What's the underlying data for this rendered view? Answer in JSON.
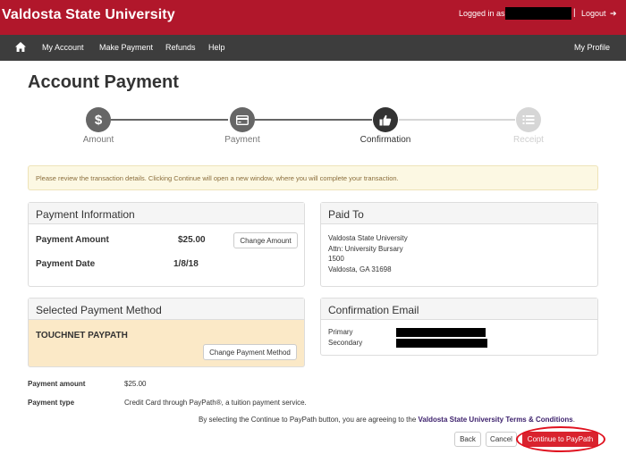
{
  "header": {
    "brand": "Valdosta State University",
    "logged_in_label": "Logged in as:",
    "separator": "|",
    "logout_label": "Logout",
    "logout_icon": "➔"
  },
  "nav": {
    "home_icon": "home-icon",
    "items": [
      "My Account",
      "Make Payment",
      "Refunds",
      "Help"
    ],
    "profile": "My Profile"
  },
  "page": {
    "title": "Account Payment"
  },
  "steps": [
    {
      "label": "Amount",
      "icon": "dollar-icon",
      "glyph": "$",
      "state": "done"
    },
    {
      "label": "Payment",
      "icon": "credit-card-icon",
      "glyph": "",
      "state": "done"
    },
    {
      "label": "Confirmation",
      "icon": "thumbs-up-icon",
      "glyph": "",
      "state": "active"
    },
    {
      "label": "Receipt",
      "icon": "list-icon",
      "glyph": "",
      "state": "disabled"
    }
  ],
  "alert": "Please review the transaction details. Clicking Continue will open a new window, where you will complete your transaction.",
  "payment_info": {
    "title": "Payment Information",
    "amount_label": "Payment Amount",
    "amount_value": "$25.00",
    "change_amount": "Change Amount",
    "date_label": "Payment Date",
    "date_value": "1/8/18"
  },
  "paid_to": {
    "title": "Paid To",
    "lines": [
      "Valdosta State University",
      "Attn: University Bursary",
      "1500",
      "Valdosta, GA 31698"
    ]
  },
  "method": {
    "title": "Selected Payment Method",
    "name": "TOUCHNET PAYPATH",
    "change_method": "Change Payment Method"
  },
  "confirmation_email": {
    "title": "Confirmation Email",
    "primary_label": "Primary",
    "secondary_label": "Secondary"
  },
  "summary": {
    "amount_label": "Payment amount",
    "amount_value": "$25.00",
    "type_label": "Payment type",
    "type_value": "Credit Card through PayPath®, a tuition payment service."
  },
  "terms": {
    "text": "By selecting the Continue to PayPath button, you are agreeing to the",
    "link": "Valdosta State University Terms & Conditions",
    "period": "."
  },
  "actions": {
    "back": "Back",
    "cancel": "Cancel",
    "continue": "Continue to PayPath"
  },
  "colors": {
    "brand_red": "#b1172b",
    "nav_dark": "#3d3d3d",
    "button_red": "#d9232e",
    "link_purple": "#3b1f6b"
  }
}
